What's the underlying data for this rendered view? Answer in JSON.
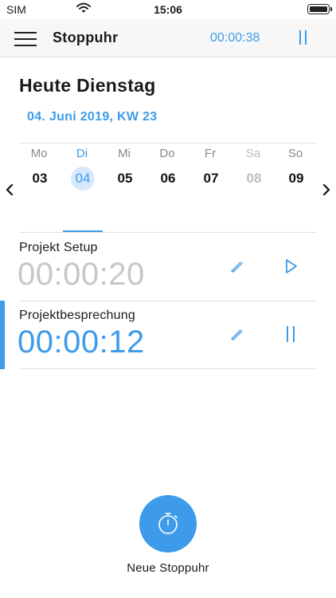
{
  "status_bar": {
    "carrier": "SIM",
    "time": "15:06",
    "wifi_icon": "wifi-icon",
    "battery_icon": "battery-icon"
  },
  "header": {
    "title": "Stoppuhr",
    "running_timer": "00:00:38",
    "menu_icon": "menu-icon",
    "pause_icon": "pause-icon"
  },
  "day_title": "Heute Dienstag",
  "date_line": "04. Juni 2019, KW 23",
  "week": {
    "prev_icon": "chevron-left-icon",
    "next_icon": "chevron-right-icon",
    "days": [
      {
        "name": "Mo",
        "num": "03"
      },
      {
        "name": "Di",
        "num": "04",
        "selected": true
      },
      {
        "name": "Mi",
        "num": "05"
      },
      {
        "name": "Do",
        "num": "06"
      },
      {
        "name": "Fr",
        "num": "07"
      },
      {
        "name": "Sa",
        "num": "08",
        "muted": true
      },
      {
        "name": "So",
        "num": "09"
      }
    ]
  },
  "entries": [
    {
      "name": "Projekt Setup",
      "time": "00:00:20",
      "state": "stopped",
      "action_icon": "play-icon"
    },
    {
      "name": "Projektbesprechung",
      "time": "00:00:12",
      "state": "running",
      "action_icon": "pause-icon"
    }
  ],
  "fab": {
    "icon": "stopwatch-icon",
    "label": "Neue Stoppuhr"
  },
  "colors": {
    "accent": "#3d9be9",
    "selected_day_bg": "#d6e9fb",
    "inactive_time": "#c7c7c7",
    "muted_day": "#bdbdbd"
  }
}
